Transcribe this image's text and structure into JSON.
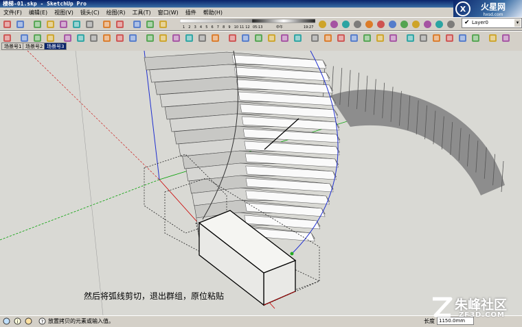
{
  "window": {
    "title": "楼梯-01.skp - SketchUp Pro"
  },
  "menu": {
    "items": [
      "文件(F)",
      "编辑(E)",
      "视图(V)",
      "镜头(C)",
      "绘图(R)",
      "工具(T)",
      "窗口(W)",
      "插件",
      "帮助(H)"
    ]
  },
  "shadow_settings": {
    "months": [
      "1",
      "2",
      "3",
      "4",
      "5",
      "6",
      "7",
      "8",
      "9",
      "10",
      "11",
      "12"
    ],
    "time_start": "05:13",
    "noon_label": "中午",
    "time_end": "19:27"
  },
  "layer": {
    "current": "Layer0",
    "visible": "✔"
  },
  "scenes": {
    "tabs": [
      "场景号1",
      "场景号2",
      "场景号3"
    ],
    "active_index": 2
  },
  "viewport": {
    "caption": "然后将弧线剪切，退出群组，原位粘贴"
  },
  "status": {
    "help_text": "放置拷贝的元素或输入值。",
    "measure_label": "长度",
    "measure_value": "1150.0mm"
  },
  "watermarks": {
    "top_right": "火星网",
    "top_right_sub": "hxsd.com",
    "bottom_right": "朱峰社区",
    "bottom_right_sub": "ZF3D.COM"
  },
  "colors": {
    "title_bar": "#0a246a",
    "viewport_bg": "#d9d9d4",
    "red_axis": "#cc0000",
    "green_axis": "#00a000",
    "blue_axis": "#1f2fd0"
  },
  "icons": {
    "toolbar_row1": [
      "new-icon",
      "open-icon",
      "save-icon",
      "cut-icon",
      "copy-icon",
      "paste-icon",
      "erase-icon",
      "undo-icon",
      "redo-icon",
      "print-icon",
      "model-info-icon",
      "walk-icon",
      "look-icon",
      "section-icon",
      "shadow-toggle-icon",
      "fog-icon",
      "photo-texture-icon",
      "sandbox-icon",
      "render-icon",
      "redraw-icon",
      "ruby-icon",
      "component-icon",
      "material-icon",
      "style-icon",
      "layer-icon",
      "outliner-icon",
      "scene-icon",
      "home-icon"
    ],
    "toolbar_row2": [
      "select-icon",
      "make-component-icon",
      "paint-icon",
      "eraser-icon",
      "rectangle-icon",
      "line-icon",
      "arc-icon",
      "circle-icon",
      "polygon-icon",
      "freehand-icon",
      "move-icon",
      "push-pull-icon",
      "rotate-icon",
      "follow-me-icon",
      "scale-icon",
      "offset-icon",
      "tape-icon",
      "dimension-icon",
      "protractor-icon",
      "text-icon",
      "axes-icon",
      "3d-text-icon",
      "orbit-icon",
      "pan-icon",
      "zoom-icon",
      "zoom-window-icon",
      "zoom-extents-icon",
      "previous-icon",
      "iso-view-icon",
      "top-view-icon",
      "front-view-icon",
      "right-view-icon",
      "back-view-icon",
      "left-view-icon",
      "xray-icon",
      "wireframe-icon",
      "hidden-line-icon",
      "shaded-icon",
      "textured-icon",
      "monochrome-icon"
    ]
  }
}
